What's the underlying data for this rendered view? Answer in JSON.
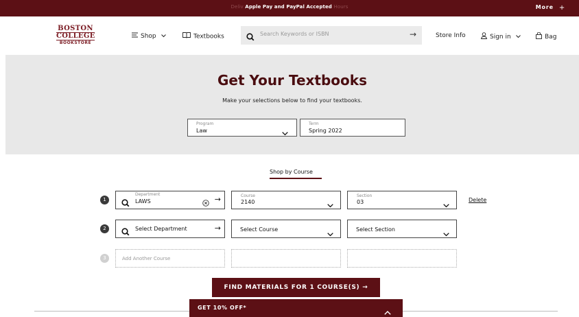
{
  "topbar": {
    "message_left": "Deliv",
    "message_main": "Apple Pay and PayPal Accepted",
    "message_right": "Hours",
    "more_label": "More",
    "plus_glyph": "+"
  },
  "logo": {
    "line1": "BOSTON",
    "line2": "COLLEGE",
    "line3": "BOOKSTORE"
  },
  "nav": {
    "shop_label": "Shop",
    "textbooks_label": "Textbooks",
    "search_placeholder": "Search Keywords or ISBN",
    "store_info_label": "Store Info",
    "sign_in_label": "Sign in",
    "bag_label": "Bag"
  },
  "hero": {
    "title": "Get Your Textbooks",
    "subtitle": "Make your selections below to find your textbooks.",
    "program": {
      "label": "Program",
      "value": "Law"
    },
    "term": {
      "label": "Term",
      "value": "Spring 2022"
    }
  },
  "shop_by_course": "Shop by Course",
  "courses": [
    {
      "number": "1",
      "department_label": "Department",
      "department_value": "LAWS",
      "course_label": "Course",
      "course_value": "2140",
      "section_label": "Section",
      "section_value": "03",
      "delete_label": "Delete"
    },
    {
      "number": "2",
      "department_value": "Select Department",
      "course_value": "Select Course",
      "section_value": "Select Section"
    },
    {
      "number": "3",
      "add_label": "Add Another Course"
    }
  ],
  "find_button": "FIND MATERIALS FOR 1 COURSE(S) →",
  "promo": {
    "label": "GET 10% OFF*"
  },
  "colors": {
    "brand": "#5c1015",
    "hero_bg": "#e8e8e8",
    "search_bg": "#ebebeb"
  }
}
